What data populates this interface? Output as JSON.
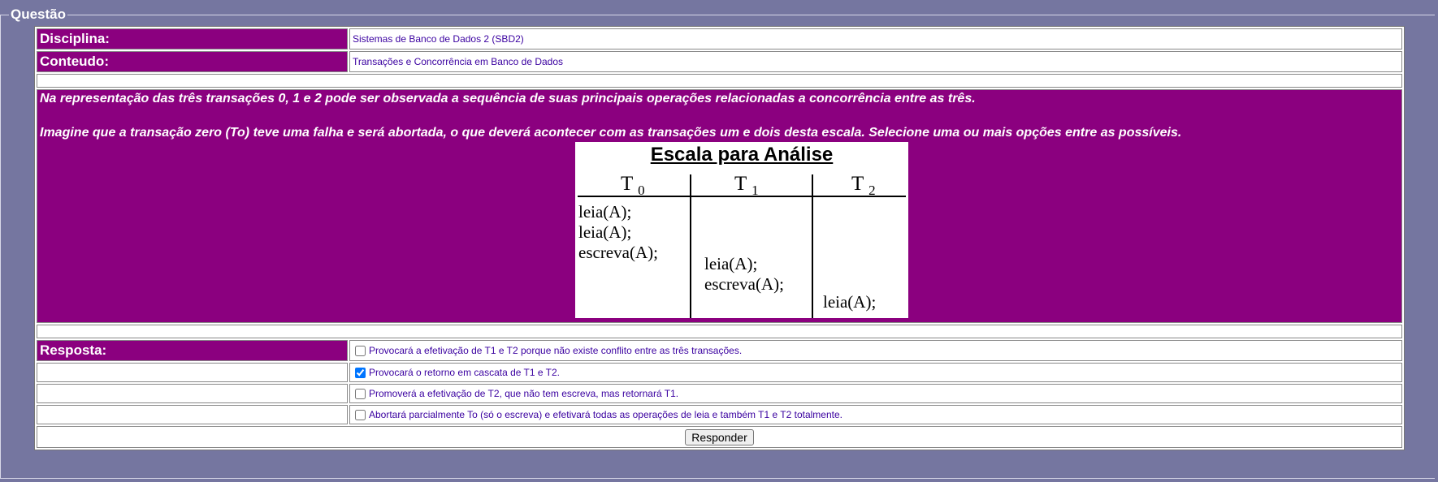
{
  "legend": "Questão",
  "info": {
    "discipline_label": "Disciplina:",
    "discipline_value": "Sistemas de Banco de Dados 2 (SBD2)",
    "content_label": "Conteudo:",
    "content_value": "Transações e Concorrência em Banco de Dados"
  },
  "question": {
    "line1": "Na representação das três transações 0, 1 e 2 pode ser observada a sequência de suas principais operações relacionadas a concorrência entre as três.",
    "line2": "Imagine que a transação zero (To) teve uma falha e será abortada, o que deverá acontecer com as transações um e dois desta escala. Selecione uma ou mais opções entre as possíveis."
  },
  "schedule": {
    "title": "Escala para Análise",
    "headers": [
      {
        "t": "T",
        "sub": "0"
      },
      {
        "t": "T",
        "sub": "1"
      },
      {
        "t": "T",
        "sub": "2"
      }
    ],
    "ops": {
      "t0": [
        "leia(A);",
        "leia(A);",
        "escreva(A);"
      ],
      "t1": [
        "leia(A);",
        "escreva(A);"
      ],
      "t2": [
        "leia(A);"
      ]
    }
  },
  "answer": {
    "label": "Resposta:",
    "options": [
      {
        "text": "Provocará a efetivação de T1 e T2 porque não existe conflito entre as três transações.",
        "checked": false
      },
      {
        "text": "Provocará o retorno em cascata de T1 e T2.",
        "checked": true
      },
      {
        "text": "Promoverá a efetivação de T2, que não tem escreva, mas retornará T1.",
        "checked": false
      },
      {
        "text": "Abortará parcialmente To (só o escreva) e efetivará todas as operações de leia e também T1 e T2 totalmente.",
        "checked": false
      }
    ],
    "submit_label": "Responder"
  }
}
